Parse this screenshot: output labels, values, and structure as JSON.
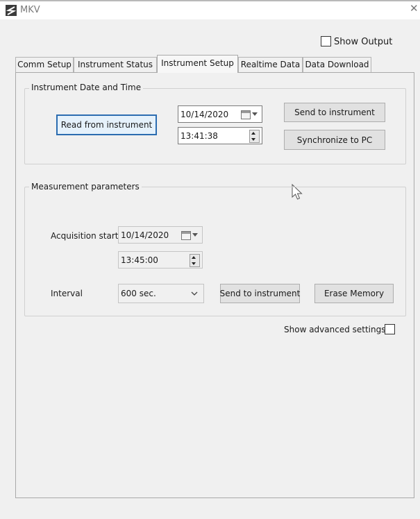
{
  "window": {
    "title": "MKV",
    "close_glyph": "✕"
  },
  "show_output": {
    "label": "Show Output",
    "checked": false
  },
  "tabs": [
    {
      "label": "Comm Setup",
      "active": false
    },
    {
      "label": "Instrument Status",
      "active": false
    },
    {
      "label": "Instrument Setup",
      "active": true
    },
    {
      "label": "Realtime Data",
      "active": false
    },
    {
      "label": "Data Download",
      "active": false
    }
  ],
  "datetime_group": {
    "title": "Instrument Date and Time",
    "read_button": "Read from instrument",
    "date_value": "10/14/2020",
    "time_value": "13:41:38",
    "send_button": "Send to instrument",
    "sync_button": "Synchronize to PC"
  },
  "measurement_group": {
    "title": "Measurement parameters",
    "acq_label": "Acquisition start",
    "acq_date": "10/14/2020",
    "acq_time": "13:45:00",
    "interval_label": "Interval",
    "interval_value": "600 sec.",
    "send_button": "Send to instrument",
    "erase_button": "Erase Memory"
  },
  "advanced": {
    "label": "Show advanced settings",
    "checked": false
  },
  "icons": [
    "app-logo-icon",
    "close-icon",
    "calendar-icon",
    "dropdown-arrow-icon",
    "spin-up-icon",
    "spin-down-icon",
    "mouse-cursor-icon"
  ],
  "colors": {
    "focus_border": "#2b6cb0",
    "panel_bg": "#f0f0f0",
    "button_bg": "#e1e1e1"
  }
}
